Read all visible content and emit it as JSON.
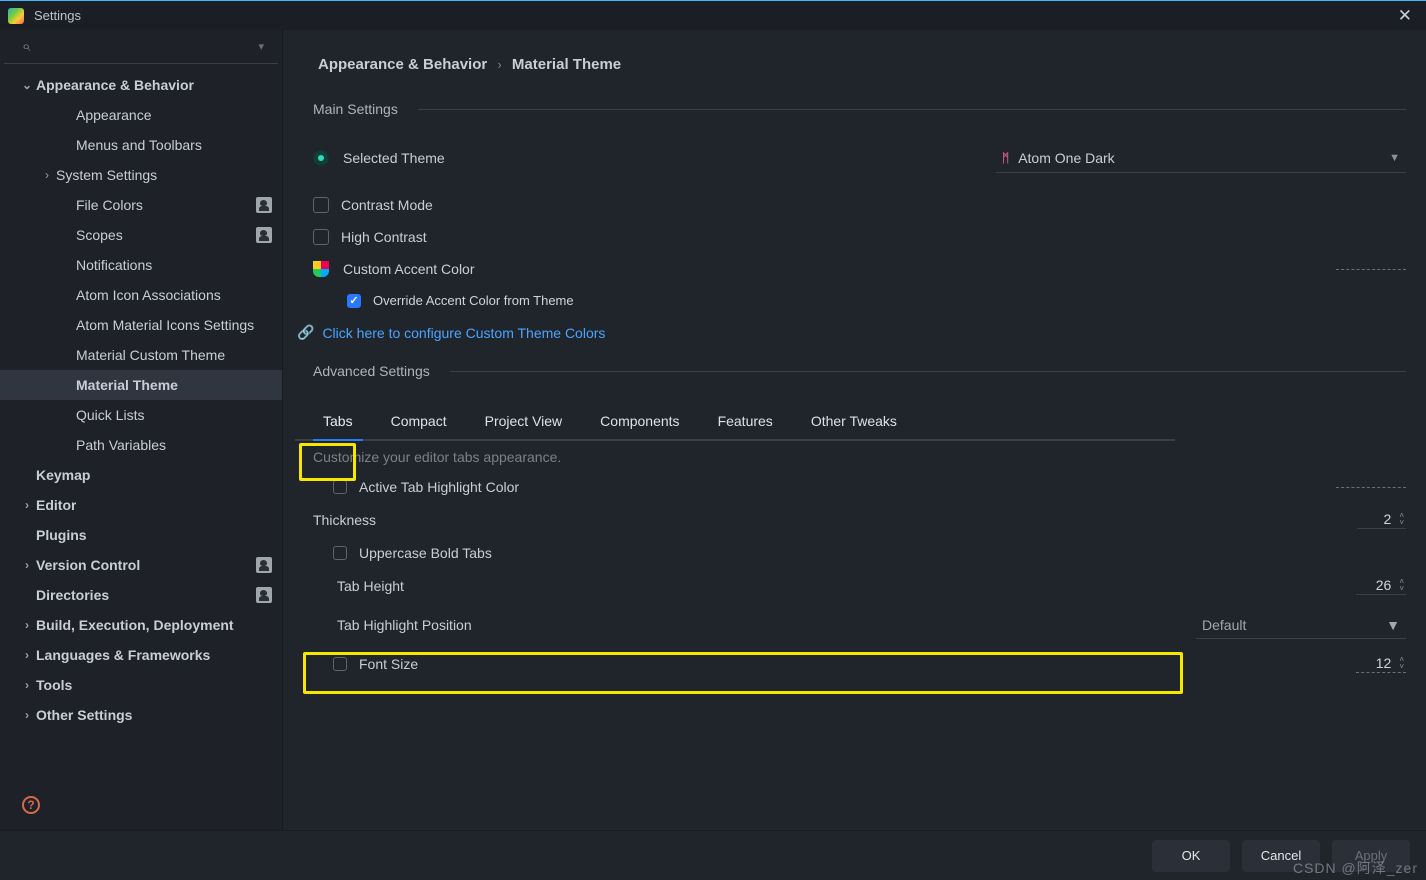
{
  "window": {
    "title": "Settings"
  },
  "tree": [
    {
      "label": "Appearance & Behavior",
      "depth": 0,
      "bold": true,
      "expanded": true,
      "exp": "down"
    },
    {
      "label": "Appearance",
      "depth": 2
    },
    {
      "label": "Menus and Toolbars",
      "depth": 2
    },
    {
      "label": "System Settings",
      "depth": 1,
      "exp": "right"
    },
    {
      "label": "File Colors",
      "depth": 2,
      "badge": true
    },
    {
      "label": "Scopes",
      "depth": 2,
      "badge": true
    },
    {
      "label": "Notifications",
      "depth": 2
    },
    {
      "label": "Atom Icon Associations",
      "depth": 2
    },
    {
      "label": "Atom Material Icons Settings",
      "depth": 2
    },
    {
      "label": "Material Custom Theme",
      "depth": 2
    },
    {
      "label": "Material Theme",
      "depth": 2,
      "selected": true,
      "bold": true
    },
    {
      "label": "Quick Lists",
      "depth": 2
    },
    {
      "label": "Path Variables",
      "depth": 2
    },
    {
      "label": "Keymap",
      "depth": 0,
      "bold": true
    },
    {
      "label": "Editor",
      "depth": 0,
      "bold": true,
      "exp": "right"
    },
    {
      "label": "Plugins",
      "depth": 0,
      "bold": true
    },
    {
      "label": "Version Control",
      "depth": 0,
      "bold": true,
      "exp": "right",
      "badge": true
    },
    {
      "label": "Directories",
      "depth": 0,
      "bold": true,
      "badge": true
    },
    {
      "label": "Build, Execution, Deployment",
      "depth": 0,
      "bold": true,
      "exp": "right"
    },
    {
      "label": "Languages & Frameworks",
      "depth": 0,
      "bold": true,
      "exp": "right"
    },
    {
      "label": "Tools",
      "depth": 0,
      "bold": true,
      "exp": "right"
    },
    {
      "label": "Other Settings",
      "depth": 0,
      "bold": true,
      "exp": "right"
    }
  ],
  "crumb": {
    "a": "Appearance & Behavior",
    "b": "Material Theme"
  },
  "main_settings": {
    "title": "Main Settings",
    "selected_theme_label": "Selected Theme",
    "selected_theme_value": "Atom One Dark",
    "contrast_mode": "Contrast Mode",
    "high_contrast": "High Contrast",
    "custom_accent": "Custom Accent Color",
    "override_accent": "Override Accent Color from Theme",
    "link_text": "Click here to configure Custom Theme Colors"
  },
  "advanced": {
    "title": "Advanced Settings"
  },
  "tabs": [
    "Tabs",
    "Compact",
    "Project View",
    "Components",
    "Features",
    "Other Tweaks"
  ],
  "tabs_panel": {
    "desc": "Customize your editor tabs appearance.",
    "active_tab_color": "Active Tab Highlight Color",
    "thickness_label": "Thickness",
    "thickness_value": "2",
    "uppercase": "Uppercase Bold Tabs",
    "tab_height_label": "Tab Height",
    "tab_height_value": "26",
    "tab_highlight_pos": "Tab Highlight Position",
    "tab_highlight_value": "Default",
    "font_size_label": "Font Size",
    "font_size_value": "12"
  },
  "footer": {
    "ok": "OK",
    "cancel": "Cancel",
    "apply": "Apply"
  },
  "watermark": "CSDN @阿泽_zer"
}
